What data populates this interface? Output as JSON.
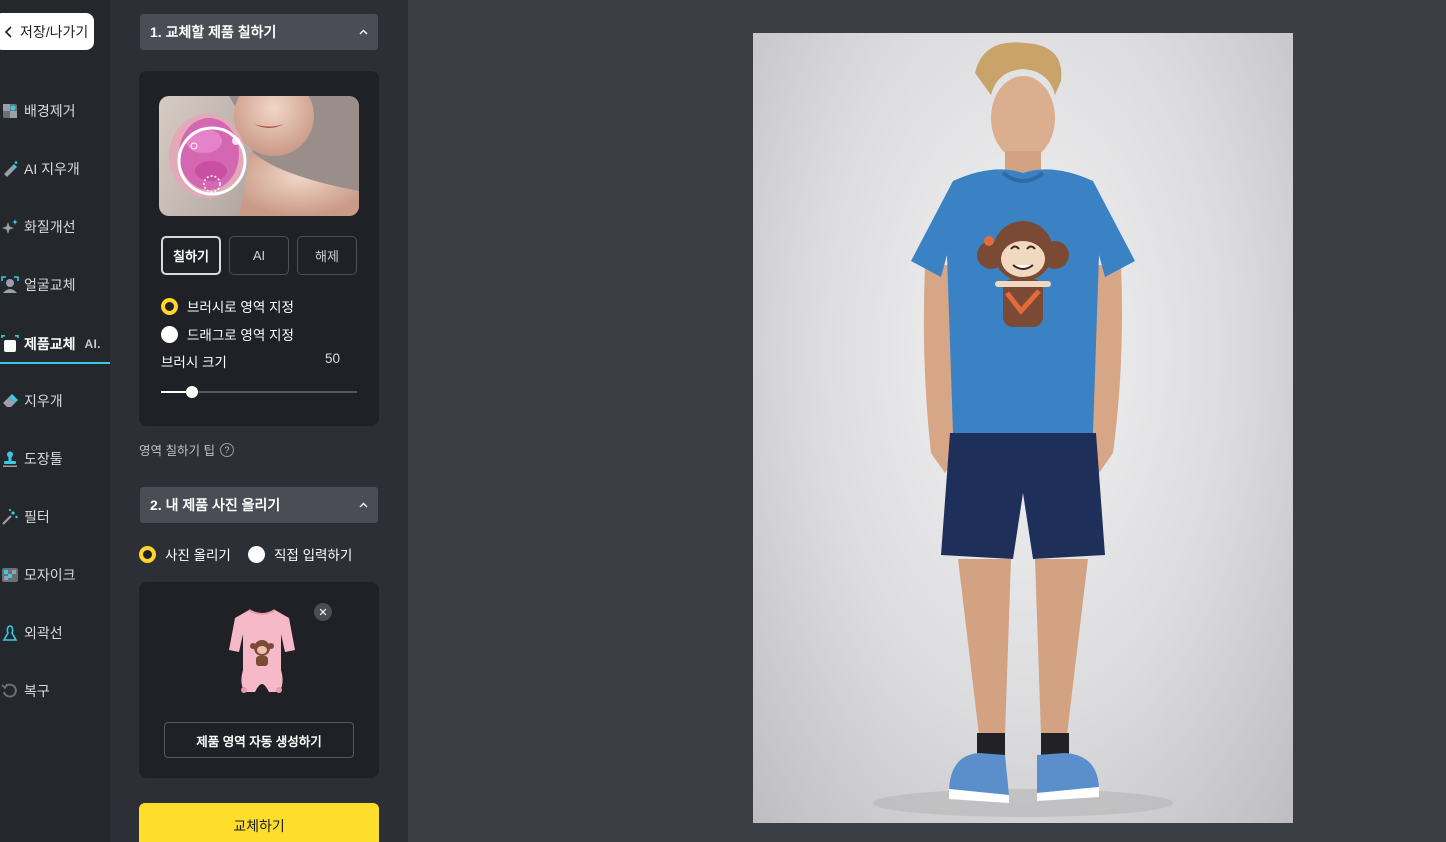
{
  "nav": {
    "back_label": "저장/나가기",
    "items": [
      {
        "label": "배경제거",
        "icon": "background-remove-icon"
      },
      {
        "label": "AI 지우개",
        "icon": "ai-eraser-icon"
      },
      {
        "label": "화질개선",
        "icon": "sparkle-icon"
      },
      {
        "label": "얼굴교체",
        "icon": "face-swap-icon"
      },
      {
        "label": "제품교체",
        "icon": "product-swap-icon",
        "badge": "AI."
      },
      {
        "label": "지우개",
        "icon": "eraser-icon"
      },
      {
        "label": "도장툴",
        "icon": "stamp-icon"
      },
      {
        "label": "필터",
        "icon": "filter-wand-icon"
      },
      {
        "label": "모자이크",
        "icon": "mosaic-icon"
      },
      {
        "label": "외곽선",
        "icon": "outline-icon"
      },
      {
        "label": "복구",
        "icon": "restore-icon"
      }
    ],
    "active_index": 4
  },
  "section1": {
    "title": "1. 교체할 제품 칠하기",
    "modes": [
      "칠하기",
      "AI",
      "해제"
    ],
    "selected_mode": 0,
    "options": [
      "브러시로 영역 지정",
      "드래그로 영역 지정"
    ],
    "selected_option": 0,
    "brush_label": "브러시 크기",
    "brush_value": "50",
    "brush_level": 0.16,
    "tip": "영역 칠하기 팁",
    "tip_icon": "question-icon"
  },
  "section2": {
    "title": "2. 내 제품 사진 올리기",
    "options": [
      "사진 올리기",
      "직접 입력하기"
    ],
    "selected_option": 0,
    "auto_button": "제품 영역 자동 생성하기",
    "remove_icon": "close-icon"
  },
  "replace_button": "교체하기",
  "colors": {
    "accent_yellow": "#ffdd2b",
    "active_underline": "#3bc7e6",
    "panel_bg": "#2c2f35",
    "canvas_bg": "#3b3e45"
  }
}
